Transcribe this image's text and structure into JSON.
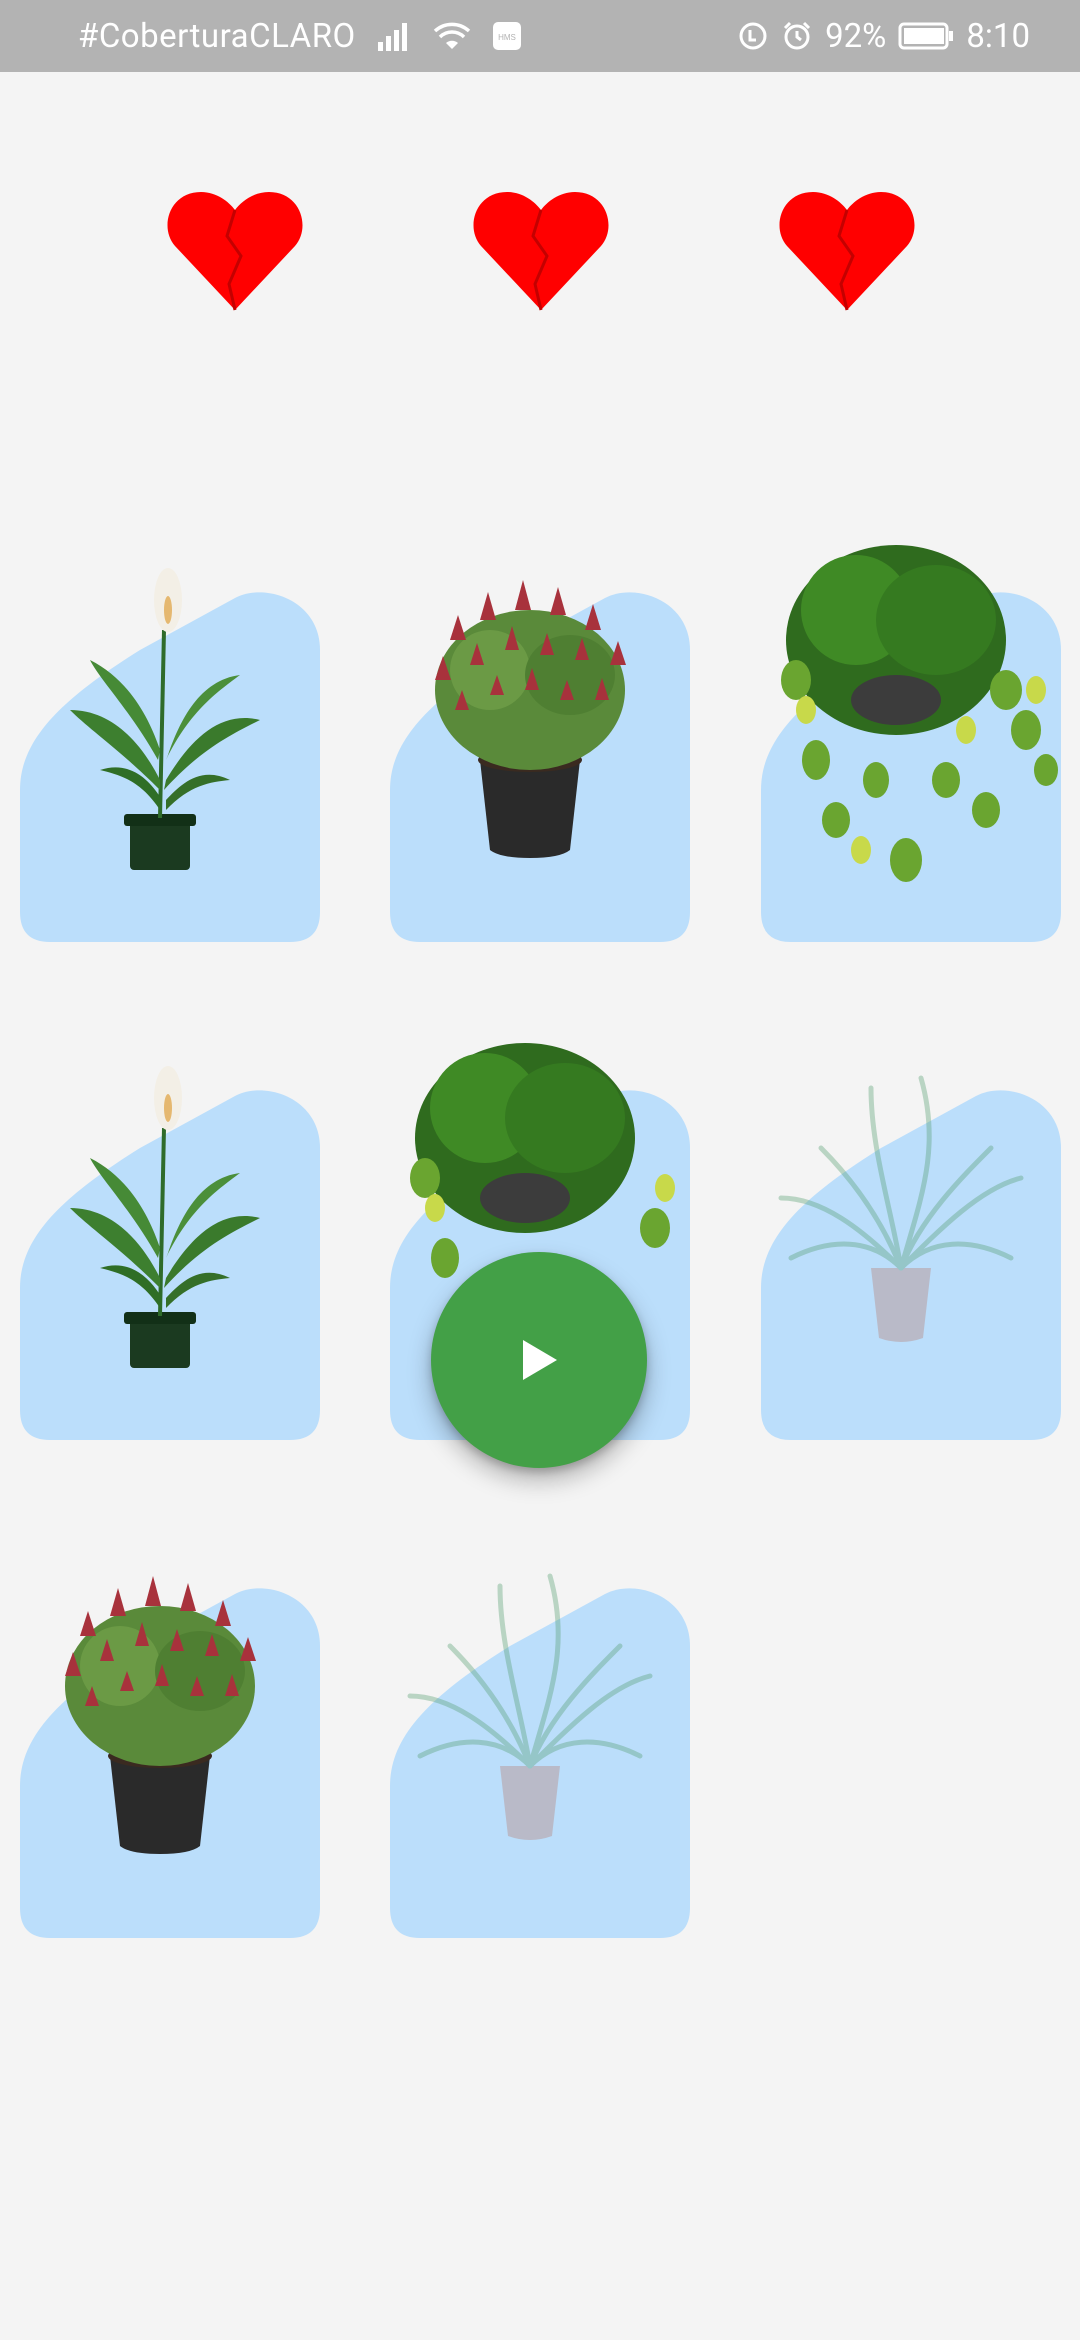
{
  "status_bar": {
    "carrier": "#CoberturaCLARO",
    "battery": "92%",
    "time": "8:10",
    "icons": [
      "signal-icon",
      "wifi-icon",
      "hms-icon",
      "data-saver-icon",
      "alarm-icon",
      "battery-icon"
    ],
    "hms_label": "HMS"
  },
  "lives": {
    "count": 3,
    "icon": "broken-heart-icon",
    "color": "#ff0000"
  },
  "cards": [
    {
      "plant": "peace-lily",
      "state": "revealed"
    },
    {
      "plant": "christmas-cactus",
      "state": "revealed"
    },
    {
      "plant": "pothos",
      "state": "revealed"
    },
    {
      "plant": "peace-lily",
      "state": "revealed"
    },
    {
      "plant": "pothos",
      "state": "revealed"
    },
    {
      "plant": "spider-plant",
      "state": "faded"
    },
    {
      "plant": "christmas-cactus",
      "state": "revealed"
    },
    {
      "plant": "spider-plant",
      "state": "faded"
    }
  ],
  "fab": {
    "icon": "play-icon",
    "color": "#43a047"
  },
  "colors": {
    "card_bg": "#bbdefb",
    "status_bar_bg": "#b3b3b3",
    "page_bg": "#f4f4f4"
  }
}
